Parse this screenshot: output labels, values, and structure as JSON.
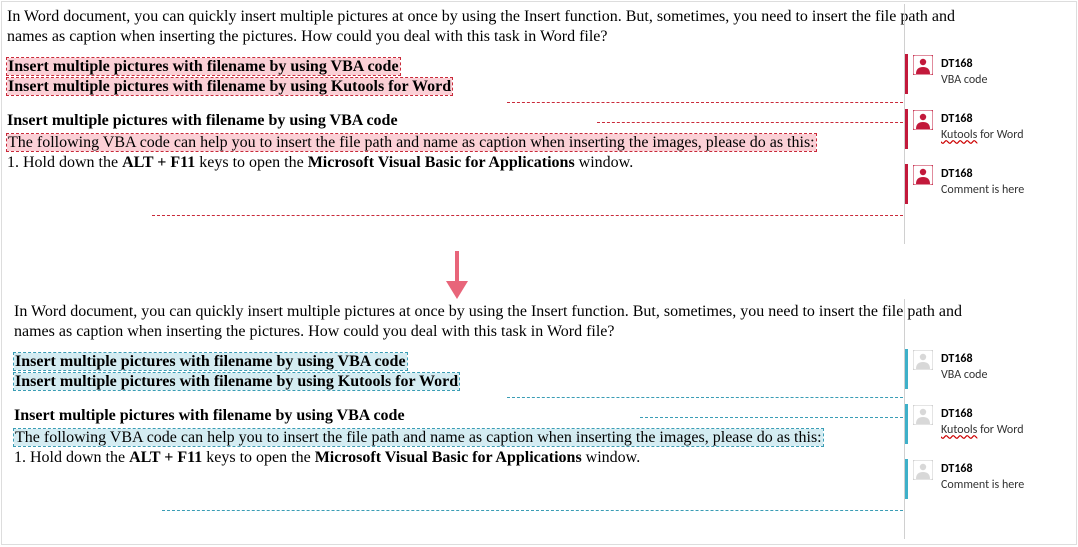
{
  "intro": "In Word document, you can quickly insert multiple pictures at once by using the Insert function. But, sometimes, you need to insert the file path and names as caption when inserting the pictures. How could you deal with this task in Word file?",
  "link1": "Insert multiple pictures with filename by using VBA code",
  "link2": "Insert multiple pictures with filename by using Kutools for Word",
  "heading": "Insert multiple pictures with filename by using VBA code",
  "body1": "The following VBA code can help you to insert the file path and name as caption when inserting the images, please do as this:",
  "step_prefix": "1. Hold down the ",
  "alt_f11": "ALT + F11",
  "keys_suffix": " keys to open the ",
  "msvba": "Microsoft Visual Basic for Applications",
  "window_suffix": " window.",
  "comments": {
    "c1_author": "DT168",
    "c1_text": "VBA code",
    "c2_author": "DT168",
    "c2_text_a": "Kutools",
    "c2_text_b": " for Word",
    "c3_author": "DT168",
    "c3_text": "Comment is here"
  }
}
